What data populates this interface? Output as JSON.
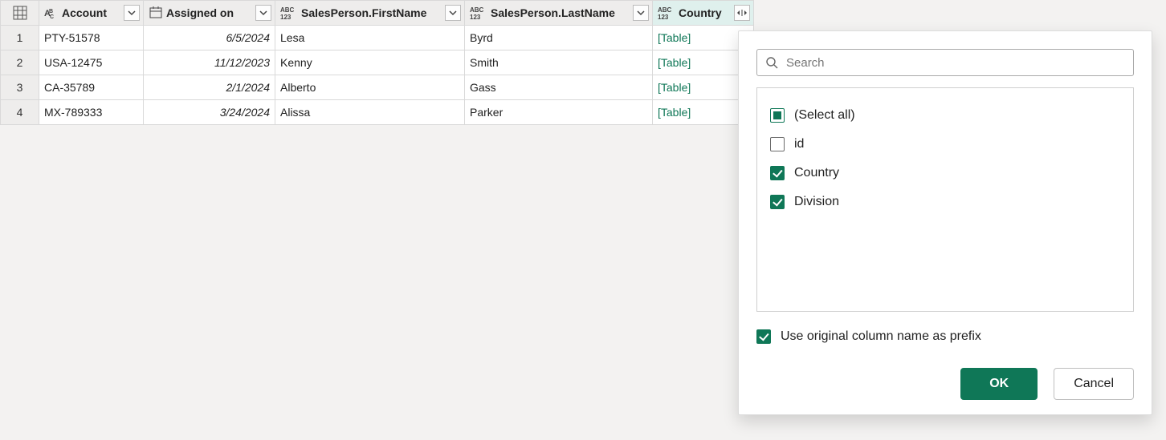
{
  "columns": {
    "account": "Account",
    "assigned": "Assigned on",
    "first": "SalesPerson.FirstName",
    "last": "SalesPerson.LastName",
    "country": "Country"
  },
  "rows": [
    {
      "n": "1",
      "account": "PTY-51578",
      "assigned": "6/5/2024",
      "first": "Lesa",
      "last": "Byrd",
      "country": "[Table]"
    },
    {
      "n": "2",
      "account": "USA-12475",
      "assigned": "11/12/2023",
      "first": "Kenny",
      "last": "Smith",
      "country": "[Table]"
    },
    {
      "n": "3",
      "account": "CA-35789",
      "assigned": "2/1/2024",
      "first": "Alberto",
      "last": "Gass",
      "country": "[Table]"
    },
    {
      "n": "4",
      "account": "MX-789333",
      "assigned": "3/24/2024",
      "first": "Alissa",
      "last": "Parker",
      "country": "[Table]"
    }
  ],
  "popup": {
    "search_placeholder": "Search",
    "options": {
      "select_all": "(Select all)",
      "id": "id",
      "country": "Country",
      "division": "Division"
    },
    "prefix_label": "Use original column name as prefix",
    "ok": "OK",
    "cancel": "Cancel"
  }
}
